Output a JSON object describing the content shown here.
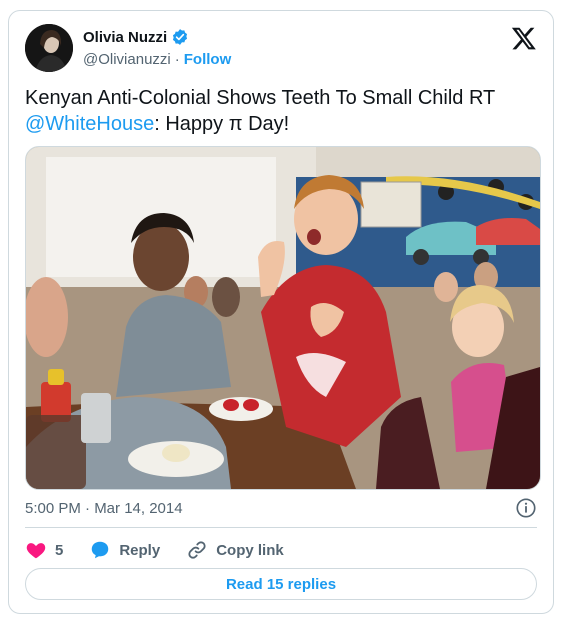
{
  "author": {
    "name": "Olivia Nuzzi",
    "handle": "@Olivianuzzi",
    "follow_label": "Follow",
    "separator": "·"
  },
  "tweet": {
    "text_main": "Kenyan Anti-Colonial Shows Teeth To Small Child RT ",
    "mention": "@WhiteHouse",
    "text_tail": ": Happy π Day!",
    "timestamp": "5:00 PM · Mar 14, 2014"
  },
  "actions": {
    "like_count": "5",
    "reply_label": "Reply",
    "copy_label": "Copy link",
    "read_replies_label": "Read 15 replies"
  },
  "colors": {
    "accent": "#1d9bf0",
    "like": "#f91880",
    "muted": "#536471"
  },
  "icons": {
    "verified": "verified-badge-icon",
    "x_logo": "x-logo-icon",
    "info": "info-icon",
    "heart": "heart-icon",
    "reply": "speech-bubble-icon",
    "link": "link-icon"
  }
}
